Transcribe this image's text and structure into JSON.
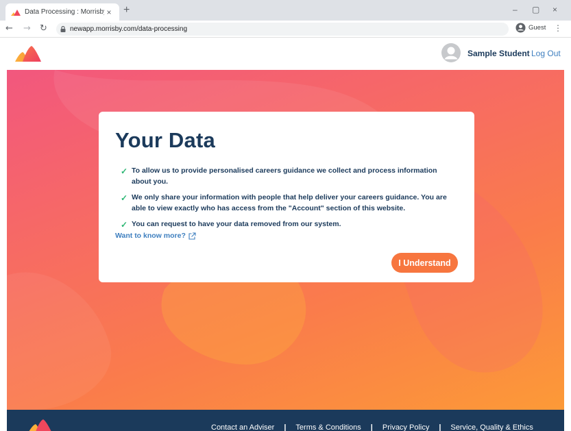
{
  "browser": {
    "tab_title": "Data Processing : Morrisby",
    "tab_close": "×",
    "new_tab": "+",
    "url": "newapp.morrisby.com/data-processing",
    "profile_label": "Guest",
    "window_controls": [
      "–",
      "▢",
      "×"
    ]
  },
  "header": {
    "user_name": "Sample Student",
    "logout_label": "Log Out"
  },
  "card": {
    "title": "Your Data",
    "points": [
      "To allow us to provide personalised careers guidance we collect and process information about you.",
      "We only share your information with people that help deliver your careers guidance. You are able to view exactly who has access from the \"Account\" section of this website.",
      "You can request to have your data removed from our system."
    ],
    "more_link": "Want to know more?",
    "button_label": "I Understand"
  },
  "footer": {
    "links": [
      "Contact an Adviser",
      "Terms & Conditions",
      "Privacy Policy",
      "Service, Quality & Ethics"
    ],
    "separator": "|"
  },
  "colors": {
    "navy": "#1b3a5b",
    "accent_orange": "#f7763f",
    "link_blue": "#3e7fbf",
    "check_green": "#2bb673"
  }
}
